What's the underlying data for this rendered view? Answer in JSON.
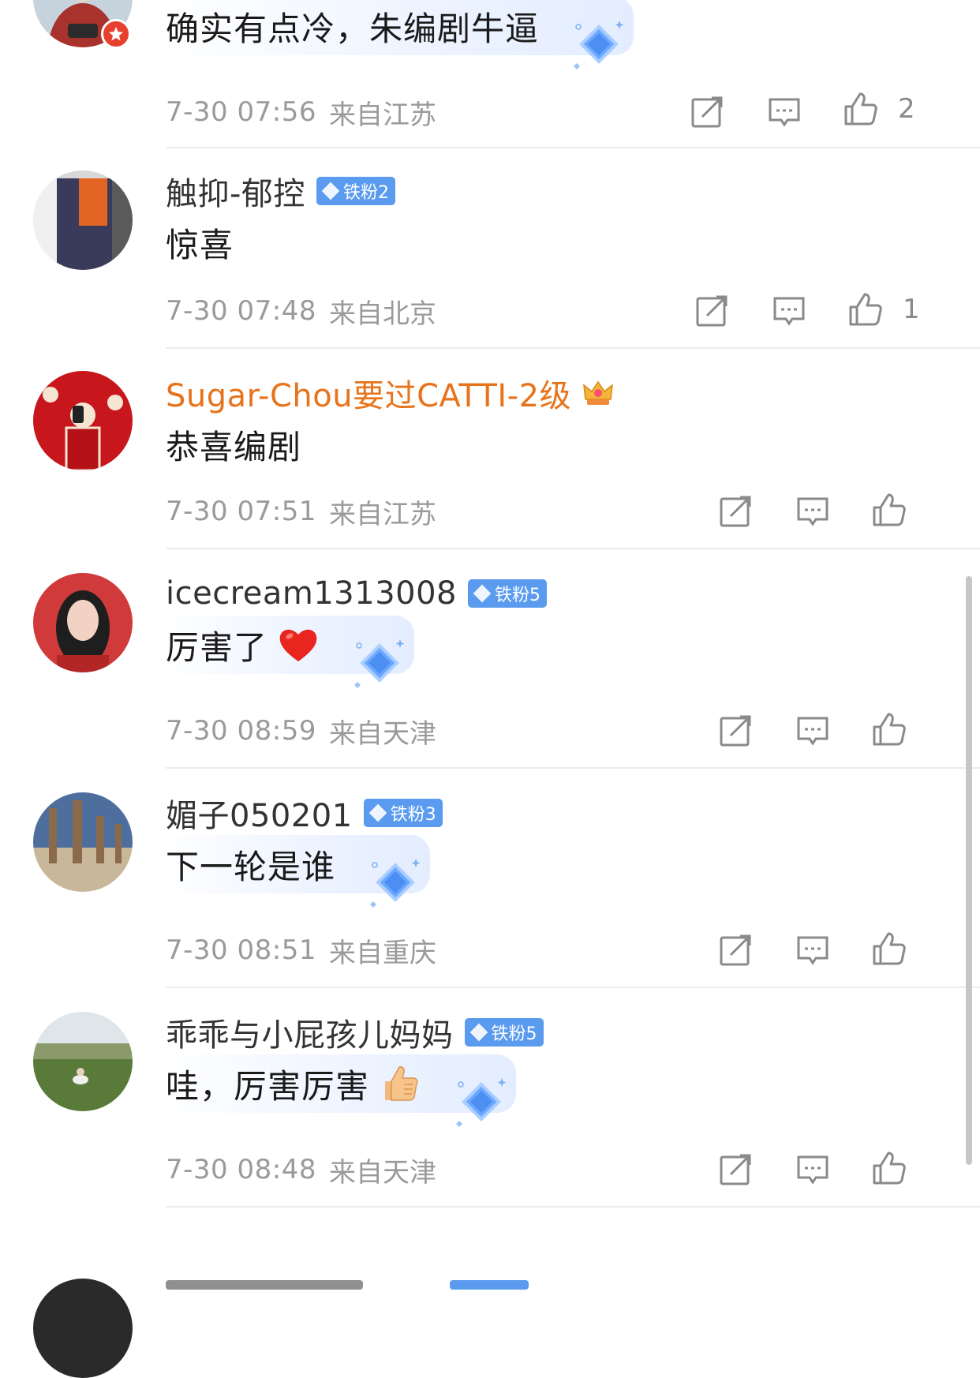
{
  "comments": [
    {
      "username": "",
      "text": "确实有点冷，朱编剧牛逼",
      "time": "7-30 07:56",
      "location": "来自江苏",
      "likes": "2",
      "has_bubble": true,
      "avatar_colors": [
        "#c7d3dc",
        "#a8322c",
        "#e9d6c3"
      ]
    },
    {
      "username": "触抑-郁控",
      "fan_badge": "铁粉2",
      "text": "惊喜",
      "time": "7-30 07:48",
      "location": "来自北京",
      "likes": "1",
      "avatar_colors": [
        "#3a3a5a",
        "#e46424",
        "#f0f0f0"
      ]
    },
    {
      "username": "Sugar-Chou要过CATTI-2级",
      "username_color": "#e8731a",
      "crown_icon": "crown-vip-icon",
      "text": "恭喜编剧",
      "time": "7-30 07:51",
      "location": "来自江苏",
      "likes": "",
      "avatar_colors": [
        "#c8161d",
        "#f5e6d3",
        "#222222"
      ]
    },
    {
      "username": "icecream1313008",
      "fan_badge": "铁粉5",
      "text": "厉害了",
      "emoji": "red-heart",
      "time": "7-30 08:59",
      "location": "来自天津",
      "likes": "",
      "has_bubble": true,
      "avatar_colors": [
        "#d13a3a",
        "#1e1e1e",
        "#f1d2c3"
      ]
    },
    {
      "username": "媚子050201",
      "fan_badge": "铁粉3",
      "text": "下一轮是谁",
      "time": "7-30 08:51",
      "location": "来自重庆",
      "likes": "",
      "has_bubble": true,
      "avatar_colors": [
        "#4e6e9e",
        "#8a6a4a",
        "#c9b79a"
      ]
    },
    {
      "username": "乖乖与小屁孩儿妈妈",
      "fan_badge": "铁粉5",
      "text": "哇，厉害厉害",
      "emoji": "thumbs-up",
      "time": "7-30 08:48",
      "location": "来自天津",
      "likes": "",
      "has_bubble": true,
      "avatar_colors": [
        "#dfe6ea",
        "#5a7a3a",
        "#8a9a6a"
      ]
    }
  ],
  "icons": {
    "share": "share-icon",
    "reply": "reply-icon",
    "like": "like-icon",
    "fan_gem": "diamond-icon"
  },
  "colors": {
    "accent_blue": "#5b9bef",
    "vip_orange": "#e8731a",
    "meta_gray": "#9a9a9a",
    "divider": "#ececec"
  }
}
